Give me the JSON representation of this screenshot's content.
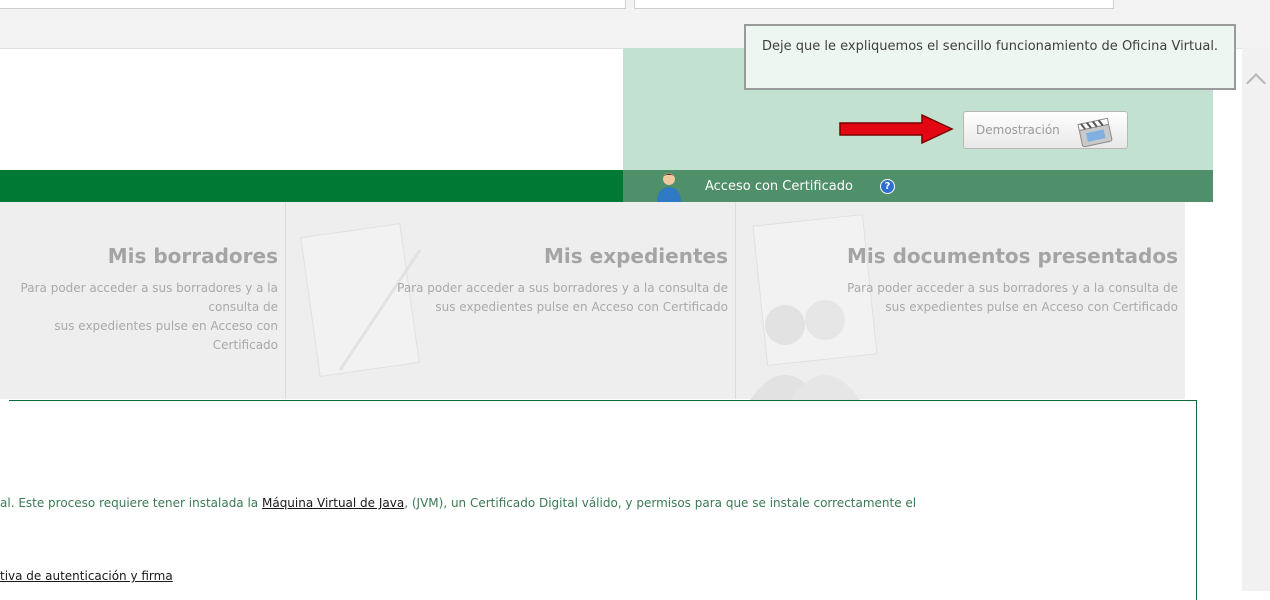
{
  "tooltip": {
    "text": "Deje que le expliquemos el sencillo funcionamiento de Oficina Virtual."
  },
  "demo": {
    "label": "Demostración",
    "icon": "film-clapper-icon"
  },
  "access": {
    "label": "Acceso con Certificado",
    "help_icon": "question-icon",
    "help_glyph": "?"
  },
  "cards": [
    {
      "title": "Mis borradores",
      "desc_line1": "Para poder acceder a sus borradores y a la consulta de",
      "desc_line2": "sus expedientes pulse en Acceso con Certificado"
    },
    {
      "title": "Mis expedientes",
      "desc_line1": "Para poder acceder a sus borradores y a la consulta de",
      "desc_line2": "sus expedientes pulse en Acceso con Certificado"
    },
    {
      "title": "Mis documentos presentados",
      "desc_line1": "Para poder acceder a sus borradores y a la consulta de",
      "desc_line2": "sus expedientes pulse en Acceso con Certificado"
    }
  ],
  "content": {
    "para_before": "al. Este proceso requiere tener instalada la ",
    "para_link": "Máquina Virtual de Java",
    "para_after": ", (JVM), un Certificado Digital válido, y permisos para que se instale correctamente el",
    "bottom_link": "tiva de autenticación y firma"
  },
  "colors": {
    "dark_green": "#007934",
    "light_green": "#c3e1d0",
    "arrow_red": "#e30613"
  }
}
